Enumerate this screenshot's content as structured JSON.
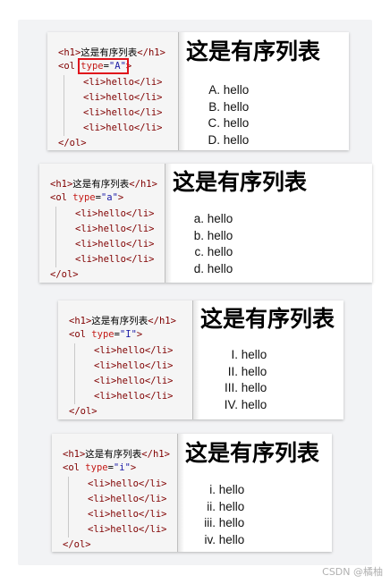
{
  "examples": [
    {
      "code": {
        "h1_open": "<h1>",
        "h1_text": "这是有序列表",
        "h1_close": "</h1>",
        "ol_open": "<ol",
        "attr_name": "type",
        "attr_eq": "=",
        "attr_value": "\"A\"",
        "ol_end": ">",
        "li_lines": [
          "<li>hello</li>",
          "<li>hello</li>",
          "<li>hello</li>",
          "<li>hello</li>"
        ],
        "ol_close": "</ol>"
      },
      "render": {
        "heading": "这是有序列表",
        "markers": [
          "A.",
          "B.",
          "C.",
          "D."
        ],
        "items": [
          "hello",
          "hello",
          "hello",
          "hello"
        ]
      },
      "highlighted": true
    },
    {
      "code": {
        "h1_open": "<h1>",
        "h1_text": "这是有序列表",
        "h1_close": "</h1>",
        "ol_open": "<ol",
        "attr_name": "type",
        "attr_eq": "=",
        "attr_value": "\"a\"",
        "ol_end": ">",
        "li_lines": [
          "<li>hello</li>",
          "<li>hello</li>",
          "<li>hello</li>",
          "<li>hello</li>"
        ],
        "ol_close": "</ol>"
      },
      "render": {
        "heading": "这是有序列表",
        "markers": [
          "a.",
          "b.",
          "c.",
          "d."
        ],
        "items": [
          "hello",
          "hello",
          "hello",
          "hello"
        ]
      },
      "highlighted": false
    },
    {
      "code": {
        "h1_open": "<h1>",
        "h1_text": "这是有序列表",
        "h1_close": "</h1>",
        "ol_open": "<ol",
        "attr_name": "type",
        "attr_eq": "=",
        "attr_value": "\"I\"",
        "ol_end": ">",
        "li_lines": [
          "<li>hello</li>",
          "<li>hello</li>",
          "<li>hello</li>",
          "<li>hello</li>"
        ],
        "ol_close": "</ol>"
      },
      "render": {
        "heading": "这是有序列表",
        "markers": [
          "I.",
          "II.",
          "III.",
          "IV."
        ],
        "items": [
          "hello",
          "hello",
          "hello",
          "hello"
        ]
      },
      "highlighted": false
    },
    {
      "code": {
        "h1_open": "<h1>",
        "h1_text": "这是有序列表",
        "h1_close": "</h1>",
        "ol_open": "<ol",
        "attr_name": "type",
        "attr_eq": "=",
        "attr_value": "\"i\"",
        "ol_end": ">",
        "li_lines": [
          "<li>hello</li>",
          "<li>hello</li>",
          "<li>hello</li>",
          "<li>hello</li>"
        ],
        "ol_close": "</ol>"
      },
      "render": {
        "heading": "这是有序列表",
        "markers": [
          "i.",
          "ii.",
          "iii.",
          "iv."
        ],
        "items": [
          "hello",
          "hello",
          "hello",
          "hello"
        ]
      },
      "highlighted": false
    }
  ],
  "watermark": "CSDN @橘柚",
  "colors": {
    "tag": "#800000",
    "attribute": "#c41a16",
    "value": "#1a1aa6",
    "highlight_box": "#e0141c"
  }
}
